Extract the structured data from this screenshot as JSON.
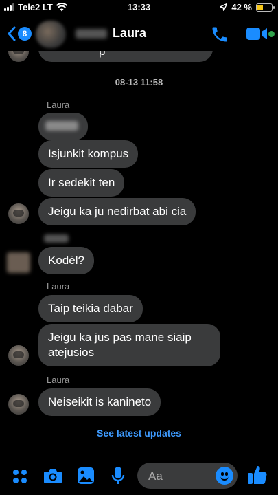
{
  "status_bar": {
    "carrier": "Tele2 LT",
    "time": "13:33",
    "battery": "42 %",
    "battery_level": 0.42
  },
  "header": {
    "back_count": "8",
    "contact_name": "Laura"
  },
  "chat": {
    "top_partial": "p",
    "timestamp": "08-13 11:58",
    "labels": {
      "laura_1": "Laura",
      "laura_2": "Laura",
      "laura_3": "Laura"
    },
    "messages": {
      "m1": "Isjunkit kompus",
      "m2": "Ir sedekit ten",
      "m3": "Jeigu ka ju nedirbat abi cia",
      "m4": "Kodėl?",
      "m5": "Taip teikia dabar",
      "m6": "Jeigu ka jus pas mane siaip atejusios",
      "m7": "Neiseikit is kanineto"
    },
    "see_latest": "See latest updates"
  },
  "composer": {
    "placeholder": "Aa"
  },
  "colors": {
    "accent": "#1a8cff",
    "bubble": "#3a3b3c",
    "link": "#3e9bff",
    "online": "#31a24c"
  }
}
